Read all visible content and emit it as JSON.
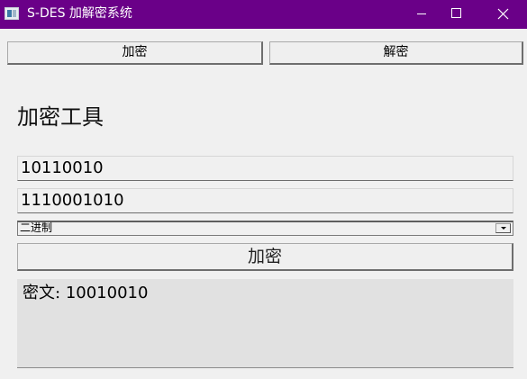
{
  "window": {
    "title": "S-DES 加解密系统",
    "icon": "app-window-icon",
    "titlebar_color": "#6a0088"
  },
  "mode_buttons": {
    "encrypt": "加密",
    "decrypt": "解密"
  },
  "panel": {
    "heading": "加密工具",
    "plaintext_value": "10110010",
    "key_value": "1110001010",
    "format_selected": "二进制",
    "action_label": "加密",
    "result_label": "密文:",
    "result_value": "10010010"
  }
}
